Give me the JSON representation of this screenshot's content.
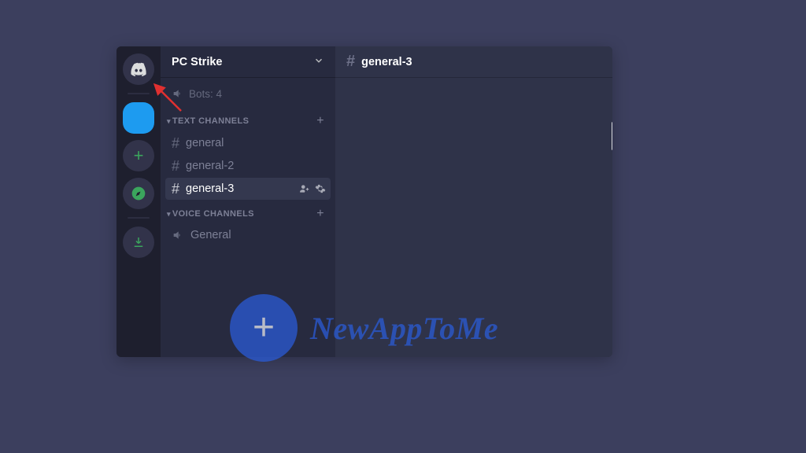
{
  "server": {
    "name": "PC Strike"
  },
  "prev_voice": "Bots: 4",
  "categories": {
    "text": {
      "label": "TEXT CHANNELS",
      "channels": [
        {
          "name": "general"
        },
        {
          "name": "general-2"
        },
        {
          "name": "general-3",
          "active": true
        }
      ]
    },
    "voice": {
      "label": "VOICE CHANNELS",
      "channels": [
        {
          "name": "General"
        }
      ]
    }
  },
  "chat": {
    "current_channel": "general-3"
  },
  "watermark": {
    "text": "NewAppToMe"
  }
}
